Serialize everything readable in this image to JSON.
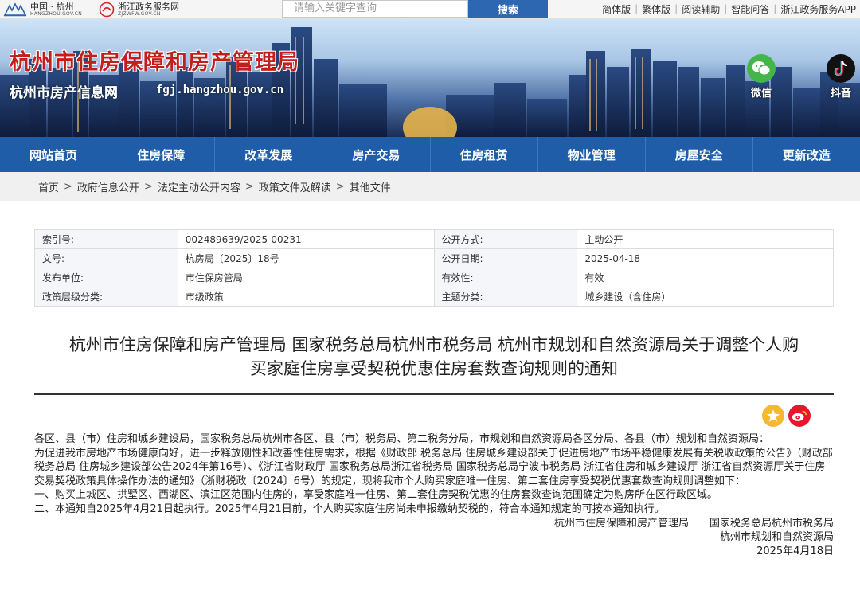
{
  "topbar": {
    "logo1_cn": "中国 · 杭州",
    "logo1_en": "HANGZHOU.GOV.CN",
    "logo2_cn": "浙江政务服务网",
    "logo2_en": "ZJZWFW.GOV.CN",
    "search_placeholder": "请输入关键字查询",
    "search_button": "搜索",
    "links": [
      "简体版",
      "繁体版",
      "阅读辅助",
      "智能问答",
      "浙江政务服务APP"
    ]
  },
  "banner": {
    "title": "杭州市住房保障和房产管理局",
    "subtitle": "杭州市房产信息网",
    "url": "fgj.hangzhou.gov.cn",
    "wechat_label": "微信",
    "douyin_label": "抖音"
  },
  "nav": [
    "网站首页",
    "住房保障",
    "改革发展",
    "房产交易",
    "住房租赁",
    "物业管理",
    "房屋安全",
    "更新改造"
  ],
  "breadcrumb": [
    "首页",
    "政府信息公开",
    "法定主动公开内容",
    "政策文件及解读",
    "其他文件"
  ],
  "info": [
    {
      "k1": "索引号:",
      "v1": "002489639/2025-00231",
      "k2": "公开方式:",
      "v2": "主动公开"
    },
    {
      "k1": "文号:",
      "v1": "杭房局〔2025〕18号",
      "k2": "公开日期:",
      "v2": "2025-04-18"
    },
    {
      "k1": "发布单位:",
      "v1": "市住保房管局",
      "k2": "有效性:",
      "v2": "有效"
    },
    {
      "k1": "政策层级分类:",
      "v1": "市级政策",
      "k2": "主题分类:",
      "v2": "城乡建设（含住房）"
    }
  ],
  "doc": {
    "title_line1": "杭州市住房保障和房产管理局 国家税务总局杭州市税务局 杭州市规划和自然资源局关于调整个人购",
    "title_line2": "买家庭住房享受契税优惠住房套数查询规则的通知",
    "paragraphs": [
      "各区、县（市）住房和城乡建设局，国家税务总局杭州市各区、县（市）税务局、第二税务分局，市规划和自然资源局各区分局、各县（市）规划和自然资源局：",
      "为促进我市房地产市场健康向好，进一步释放刚性和改善性住房需求，根据《财政部 税务总局 住房城乡建设部关于促进房地产市场平稳健康发展有关税收政策的公告》（财政部 税务总局 住房城乡建设部公告2024年第16号）、《浙江省财政厅 国家税务总局浙江省税务局 国家税务总局宁波市税务局 浙江省住房和城乡建设厅 浙江省自然资源厅关于住房交易契税政策具体操作办法的通知》（浙财税政〔2024〕6号）的规定，现将我市个人购买家庭唯一住房、第二套住房享受契税优惠套数查询规则调整如下：",
      "一、购买上城区、拱墅区、西湖区、滨江区范围内住房的，享受家庭唯一住房、第二套住房契税优惠的住房套数查询范围确定为购房所在区行政区域。",
      "二、本通知自2025年4月21日起执行。2025年4月21日前，个人购买家庭住房尚未申报缴纳契税的，符合本通知规定的可按本通知执行。"
    ],
    "signers_line1": "杭州市住房保障和房产管理局　　国家税务总局杭州市税务局",
    "signers_line2": "杭州市规划和自然资源局",
    "date": "2025年4月18日"
  }
}
